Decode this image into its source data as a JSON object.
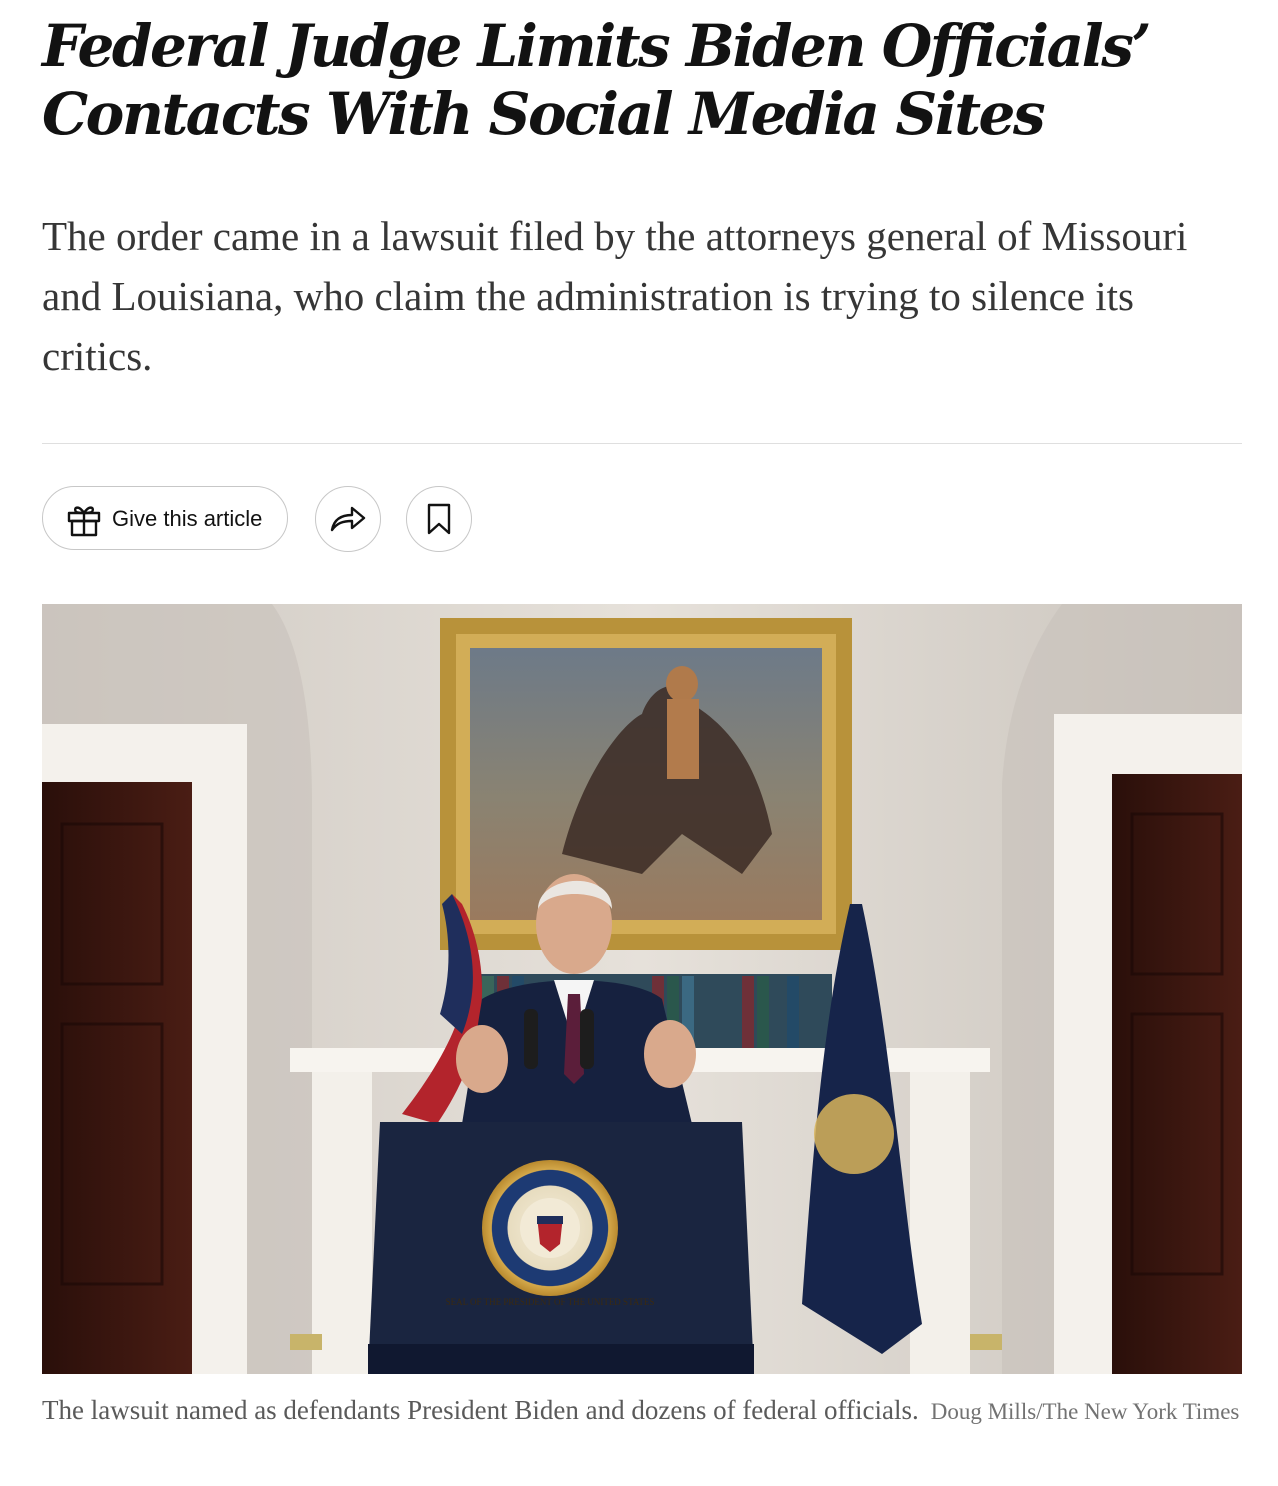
{
  "article": {
    "headline": "Federal Judge Limits Biden Officials’ Contacts With Social Media Sites",
    "summary": "The order came in a lawsuit filed by the attorneys general of Missouri and Louisiana, who claim the administration is trying to silence its critics."
  },
  "share_tools": {
    "gift_label": "Give this article",
    "gift_icon": "gift-icon",
    "share_icon": "share-arrow-icon",
    "save_icon": "bookmark-icon"
  },
  "media": {
    "caption": "The lawsuit named as defendants President Biden and dozens of federal officials.",
    "credit": "Doug Mills/The New York Times",
    "seal_text": "SEAL OF THE PRESIDENT OF THE UNITED STATES"
  },
  "colors": {
    "headline": "#121212",
    "summary": "#363636",
    "caption": "#5a5a5a",
    "credit": "#727272",
    "border": "#c7c7c7"
  }
}
